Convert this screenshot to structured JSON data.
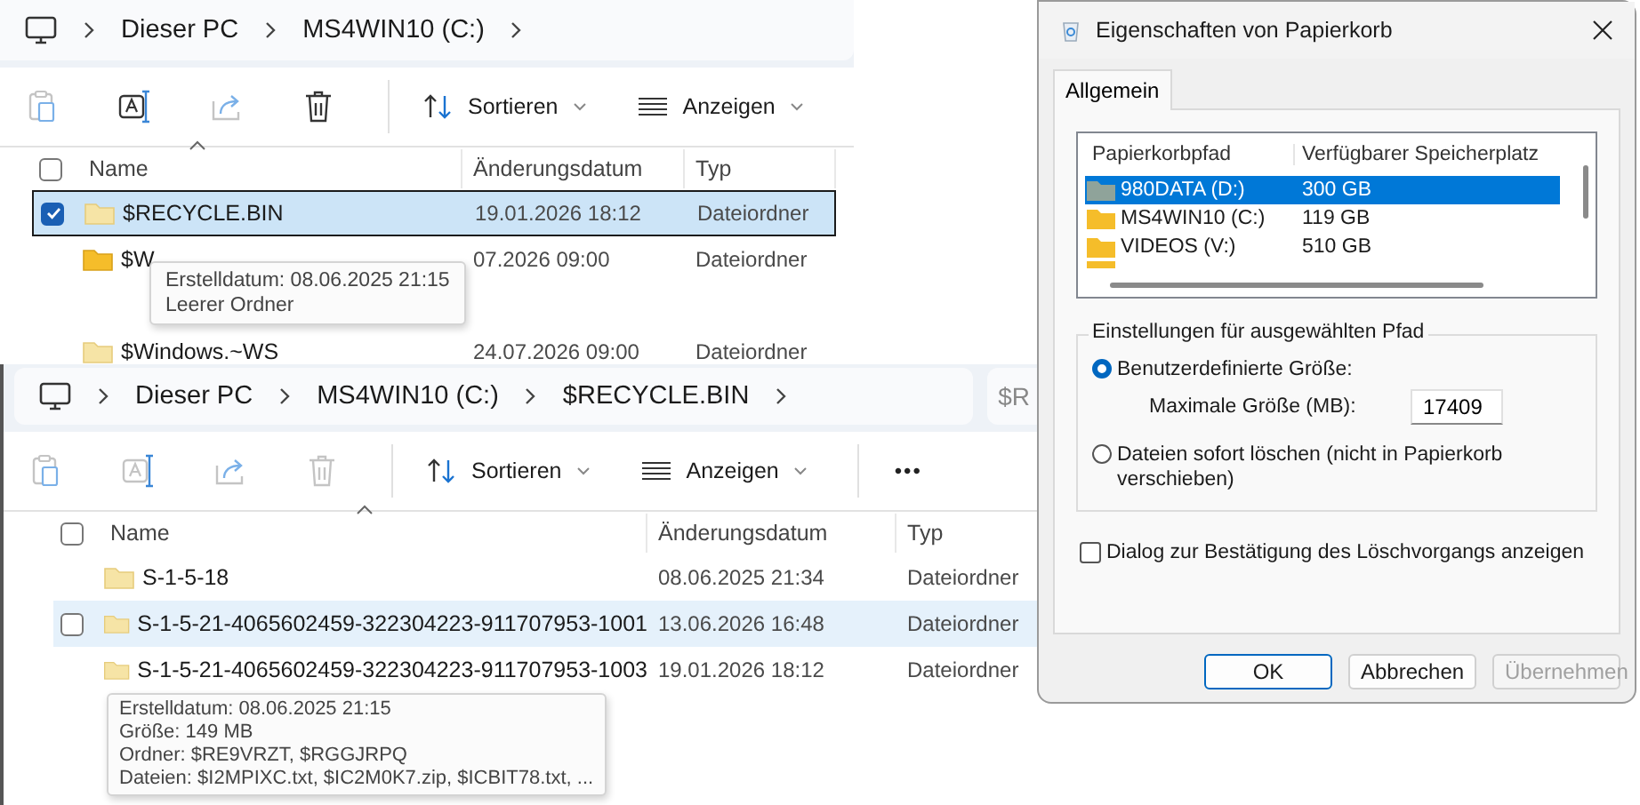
{
  "explorer_top": {
    "breadcrumb": [
      "Dieser PC",
      "MS4WIN10 (C:)"
    ],
    "toolbar": [
      {
        "kind": "paste",
        "disabled": true
      },
      {
        "kind": "rename",
        "disabled": false
      },
      {
        "kind": "share",
        "disabled": true
      },
      {
        "kind": "delete",
        "disabled": false
      },
      {
        "kind": "sort",
        "label": "Sortieren"
      },
      {
        "kind": "view",
        "label": "Anzeigen"
      }
    ],
    "header_checked": false,
    "columns": [
      "Name",
      "Änderungsdatum",
      "Typ"
    ],
    "rows": [
      {
        "name": "$RECYCLE.BIN",
        "date": "19.01.2026 18:12",
        "type": "Dateiordner",
        "selected": true,
        "hovered": false,
        "checked": true,
        "hidden": true
      },
      {
        "name": "$W",
        "date": "07.2026 09:00",
        "type": "Dateiordner",
        "selected": false,
        "hovered": false,
        "hidden": false,
        "tooltip": [
          "Erstelldatum: 08.06.2025 21:15",
          "Leerer Ordner"
        ]
      },
      {
        "name": "$Windows.~WS",
        "date": "24.07.2026 09:00",
        "type": "Dateiordner",
        "selected": false,
        "hovered": false,
        "hidden": true
      }
    ]
  },
  "explorer_bottom": {
    "breadcrumb": [
      "Dieser PC",
      "MS4WIN10 (C:)",
      "$RECYCLE.BIN"
    ],
    "side_address": "$R",
    "toolbar": [
      {
        "kind": "paste",
        "disabled": true
      },
      {
        "kind": "rename",
        "disabled": true
      },
      {
        "kind": "share",
        "disabled": true
      },
      {
        "kind": "delete",
        "disabled": true
      },
      {
        "kind": "sort",
        "label": "Sortieren"
      },
      {
        "kind": "view",
        "label": "Anzeigen"
      },
      {
        "kind": "more",
        "label": "•••"
      }
    ],
    "header_checked": false,
    "columns": [
      "Name",
      "Änderungsdatum",
      "Typ"
    ],
    "rows": [
      {
        "name": "S-1-5-18",
        "date": "08.06.2025 21:34",
        "type": "Dateiordner",
        "selected": false,
        "hovered": false,
        "hidden": true
      },
      {
        "name": "S-1-5-21-4065602459-322304223-911707953-1001",
        "date": "13.06.2026 16:48",
        "type": "Dateiordner",
        "selected": false,
        "hovered": true,
        "checked": false,
        "hidden": true
      },
      {
        "name": "S-1-5-21-4065602459-322304223-911707953-1003",
        "date": "19.01.2026 18:12",
        "type": "Dateiordner",
        "selected": false,
        "hovered": false,
        "hidden": true,
        "tooltip": [
          "Erstelldatum: 08.06.2025 21:15",
          "Größe: 149 MB",
          "Ordner: $RE9VRZT, $RGGJRPQ",
          "Dateien: $I2MPIXC.txt, $IC2M0K7.zip, $ICBIT78.txt, ..."
        ]
      }
    ]
  },
  "dialog": {
    "title": "Eigenschaften von Papierkorb",
    "tabs": [
      {
        "label": "Allgemein",
        "selected": true
      }
    ],
    "list_columns": [
      "Papierkorbpfad",
      "Verfügbarer Speicherplatz"
    ],
    "list_rows": [
      {
        "path": "980DATA (D:)",
        "space": "300 GB",
        "selected": true
      },
      {
        "path": "MS4WIN10 (C:)",
        "space": "119 GB",
        "selected": false
      },
      {
        "path": "VIDEOS (V:)",
        "space": "510 GB",
        "selected": false
      }
    ],
    "group_title": "Einstellungen für ausgewählten Pfad",
    "options": [
      {
        "label": "Benutzerdefinierte Größe:",
        "selected": true,
        "field": {
          "label": "Maximale Größe (MB):",
          "value": "17409"
        }
      },
      {
        "label": "Dateien sofort löschen (nicht in Papierkorb verschieben)",
        "selected": false
      }
    ],
    "confirm": {
      "label": "Dialog zur Bestätigung des Löschvorgangs anzeigen",
      "checked": false
    },
    "buttons": [
      {
        "label": "OK",
        "default": true,
        "disabled": false
      },
      {
        "label": "Abbrechen",
        "default": false,
        "disabled": false
      },
      {
        "label": "Übernehmen",
        "default": false,
        "disabled": true
      }
    ]
  }
}
